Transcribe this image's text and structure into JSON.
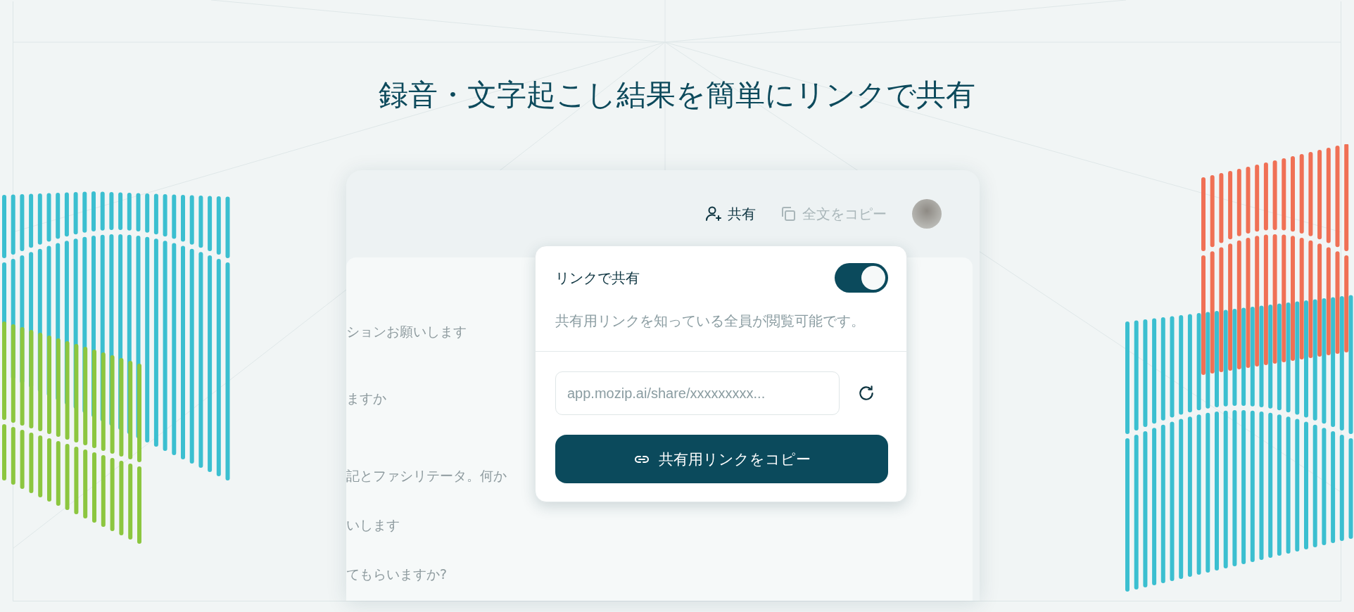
{
  "headline": "録音・文字起こし結果を簡単にリンクで共有",
  "toolbar": {
    "share_button": "共有",
    "copy_all_button": {
      "label": "全文をコピー",
      "disabled": true
    }
  },
  "transcript_lines": [
    "ションお願いします",
    "ますか",
    "記とファシリテータ。何か",
    "いします",
    "てもらいますか?"
  ],
  "share_popover": {
    "title": "リンクで共有",
    "link_sharing_on": true,
    "description": "共有用リンクを知っている全員が閲覧可能です。",
    "link_field": {
      "value": "app.mozip.ai/share/xxxxxxxxx..."
    },
    "copy_button": "共有用リンクをコピー"
  }
}
